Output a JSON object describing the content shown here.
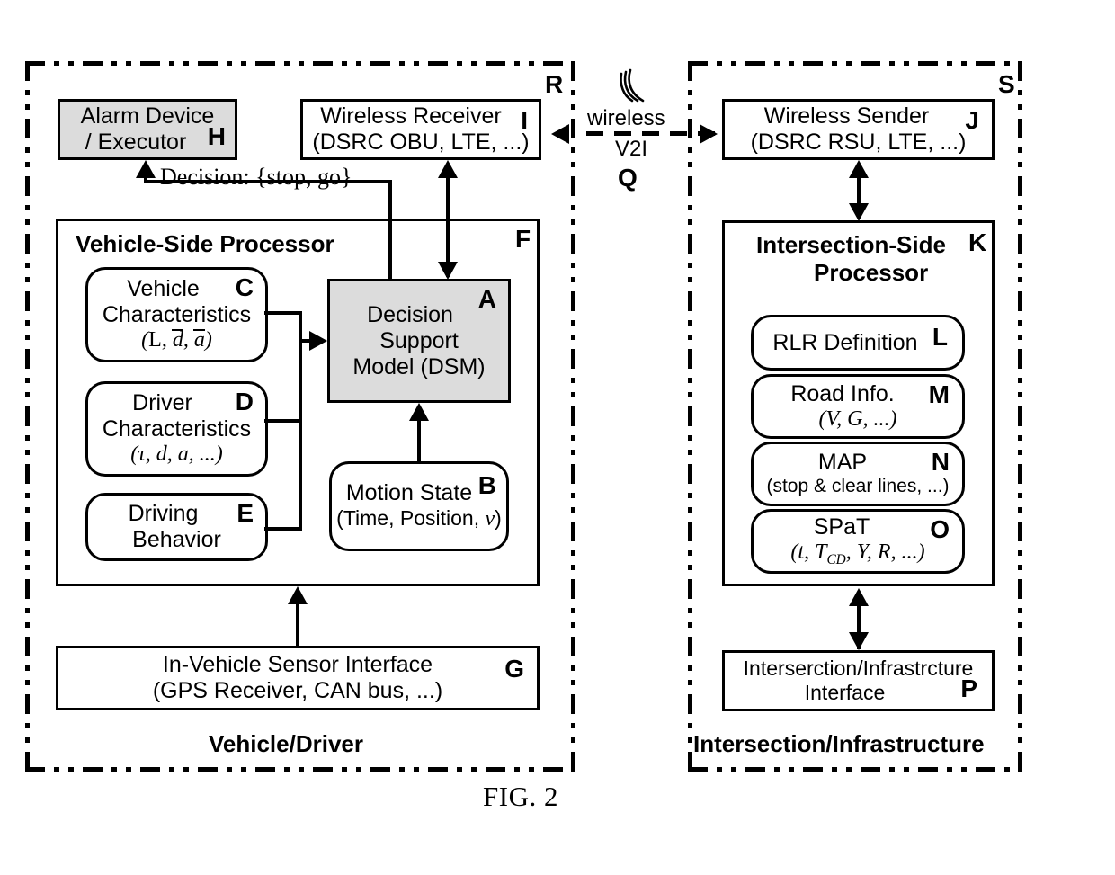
{
  "figure": {
    "caption": "FIG. 2"
  },
  "zones": {
    "vehicle": {
      "tag": "R",
      "title": "Vehicle/Driver"
    },
    "intersection": {
      "tag": "S",
      "title": "Intersection/Infrastructure"
    }
  },
  "wireless_link": {
    "label_line1": "wireless",
    "label_line2": "V2I",
    "tag": "Q",
    "icon": "wireless-antenna-icon"
  },
  "vehicle_side": {
    "alarm": {
      "tag": "H",
      "line1": "Alarm Device",
      "line2": "/ Executor"
    },
    "receiver": {
      "tag": "I",
      "line1": "Wireless Receiver",
      "line2": "(DSRC OBU, LTE, ...)"
    },
    "decision_label": "Decision: {stop, go}",
    "processor": {
      "tag": "F",
      "title": "Vehicle-Side Processor"
    },
    "vehicle_characteristics": {
      "tag": "C",
      "line1": "Vehicle",
      "line2": "Characteristics",
      "params": "(L, d̄, ā)"
    },
    "driver_characteristics": {
      "tag": "D",
      "line1": "Driver",
      "line2": "Characteristics",
      "params": "(τ, d, a, ...)"
    },
    "driving_behavior": {
      "tag": "E",
      "line1": "Driving",
      "line2": "Behavior"
    },
    "dsm": {
      "tag": "A",
      "line1": "Decision",
      "line2": "Support",
      "line3": "Model (DSM)"
    },
    "motion_state": {
      "tag": "B",
      "line1": "Motion State",
      "line2": "(Time, Position, v)"
    },
    "sensor_interface": {
      "tag": "G",
      "line1": "In-Vehicle Sensor Interface",
      "line2": "(GPS Receiver, CAN bus, ...)"
    }
  },
  "intersection_side": {
    "sender": {
      "tag": "J",
      "line1": "Wireless Sender",
      "line2": "(DSRC RSU, LTE, ...)"
    },
    "processor": {
      "tag": "K",
      "title_line1": "Intersection-Side",
      "title_line2": "Processor"
    },
    "rlr_definition": {
      "tag": "L",
      "line1": "RLR Definition"
    },
    "road_info": {
      "tag": "M",
      "line1": "Road Info.",
      "params": "(V, G, ...)"
    },
    "map": {
      "tag": "N",
      "line1": "MAP",
      "line2": "(stop & clear lines, ...)"
    },
    "spat": {
      "tag": "O",
      "line1": "SPaT",
      "params": "(t, T_CD, Y, R, ...)"
    },
    "infrastructure_interface": {
      "tag": "P",
      "line1": "Interserction/Infrastrcture",
      "line2": "Interface"
    }
  },
  "colors": {
    "ink": "#000000",
    "background": "#ffffff",
    "shaded_fill": "#dcdcdc"
  }
}
